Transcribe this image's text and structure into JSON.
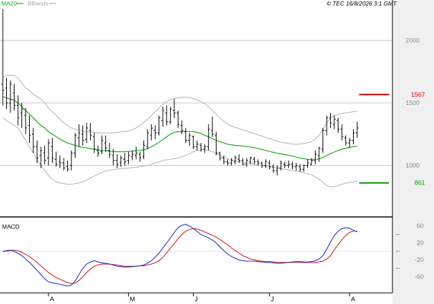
{
  "legend": {
    "ma_label": "MA20",
    "bands_label": "BBands"
  },
  "copyright": "© TEC 16/8/2026 3:1 GMT",
  "colors": {
    "ma": "#1aaa1a",
    "bands": "#b0b0b0",
    "price": "#000000",
    "macd": "#2233cc",
    "signal": "#cc2222",
    "resistance": "#cc0000",
    "support": "#009900",
    "grid": "#c8c8c8",
    "sidebar": "#f0f0f0"
  },
  "chart_data": [
    {
      "type": "line",
      "name": "price",
      "ylim": [
        600,
        2300
      ],
      "y_ticks": [
        1000,
        1500,
        2000
      ],
      "y_tick_labels": [
        "1000",
        "1500",
        "2000"
      ],
      "x_tick_labels": [
        "A",
        "M",
        "J",
        "J",
        "A"
      ],
      "x_tick_index": [
        12,
        33,
        50,
        70,
        91
      ],
      "resistance": {
        "value": 1567,
        "label": "1567"
      },
      "support": {
        "value": 861,
        "label": "861"
      },
      "bars": [
        [
          1650,
          2250,
          1480,
          1600
        ],
        [
          1620,
          1700,
          1450,
          1500
        ],
        [
          1500,
          1680,
          1420,
          1650
        ],
        [
          1580,
          1650,
          1440,
          1480
        ],
        [
          1480,
          1560,
          1320,
          1380
        ],
        [
          1420,
          1500,
          1300,
          1450
        ],
        [
          1400,
          1460,
          1250,
          1300
        ],
        [
          1320,
          1400,
          1180,
          1240
        ],
        [
          1250,
          1300,
          1100,
          1150
        ],
        [
          1150,
          1200,
          1020,
          1060
        ],
        [
          1080,
          1150,
          980,
          1120
        ],
        [
          1100,
          1160,
          1010,
          1040
        ],
        [
          1060,
          1210,
          1000,
          1180
        ],
        [
          1150,
          1220,
          1020,
          1060
        ],
        [
          1050,
          1110,
          990,
          1010
        ],
        [
          1030,
          1080,
          980,
          1020
        ],
        [
          1020,
          1060,
          960,
          980
        ],
        [
          990,
          1040,
          950,
          970
        ],
        [
          1000,
          1120,
          960,
          1100
        ],
        [
          1100,
          1260,
          1060,
          1240
        ],
        [
          1220,
          1330,
          1150,
          1260
        ],
        [
          1250,
          1320,
          1160,
          1200
        ],
        [
          1210,
          1340,
          1180,
          1300
        ],
        [
          1280,
          1340,
          1200,
          1240
        ],
        [
          1230,
          1260,
          1100,
          1130
        ],
        [
          1120,
          1160,
          1070,
          1100
        ],
        [
          1110,
          1240,
          1090,
          1200
        ],
        [
          1180,
          1240,
          1110,
          1140
        ],
        [
          1120,
          1180,
          1060,
          1090
        ],
        [
          1080,
          1130,
          1000,
          1040
        ],
        [
          1040,
          1090,
          980,
          1010
        ],
        [
          1020,
          1080,
          990,
          1060
        ],
        [
          1050,
          1100,
          1000,
          1030
        ],
        [
          1040,
          1110,
          1010,
          1080
        ],
        [
          1070,
          1120,
          1040,
          1090
        ],
        [
          1080,
          1150,
          1050,
          1100
        ],
        [
          1090,
          1110,
          1030,
          1060
        ],
        [
          1070,
          1200,
          1050,
          1160
        ],
        [
          1150,
          1290,
          1130,
          1260
        ],
        [
          1240,
          1330,
          1200,
          1300
        ],
        [
          1280,
          1320,
          1210,
          1260
        ],
        [
          1260,
          1400,
          1240,
          1380
        ],
        [
          1360,
          1470,
          1310,
          1440
        ],
        [
          1420,
          1480,
          1320,
          1350
        ],
        [
          1350,
          1470,
          1330,
          1450
        ],
        [
          1440,
          1530,
          1380,
          1420
        ],
        [
          1420,
          1440,
          1300,
          1330
        ],
        [
          1320,
          1360,
          1250,
          1280
        ],
        [
          1270,
          1300,
          1180,
          1200
        ],
        [
          1200,
          1260,
          1160,
          1240
        ],
        [
          1230,
          1240,
          1130,
          1150
        ],
        [
          1150,
          1200,
          1120,
          1170
        ],
        [
          1160,
          1180,
          1110,
          1130
        ],
        [
          1130,
          1170,
          1100,
          1150
        ],
        [
          1150,
          1330,
          1120,
          1290
        ],
        [
          1280,
          1390,
          1230,
          1250
        ],
        [
          1240,
          1270,
          1080,
          1100
        ],
        [
          1100,
          1110,
          1040,
          1060
        ],
        [
          1060,
          1080,
          1010,
          1030
        ],
        [
          1030,
          1050,
          1000,
          1020
        ],
        [
          1020,
          1060,
          1000,
          1040
        ],
        [
          1030,
          1080,
          1010,
          1060
        ],
        [
          1050,
          1090,
          1020,
          1040
        ],
        [
          1040,
          1060,
          1000,
          1010
        ],
        [
          1010,
          1060,
          990,
          1040
        ],
        [
          1030,
          1070,
          1010,
          1060
        ],
        [
          1050,
          1070,
          1010,
          1030
        ],
        [
          1030,
          1050,
          1000,
          1020
        ],
        [
          1020,
          1030,
          980,
          1000
        ],
        [
          1000,
          1050,
          980,
          1030
        ],
        [
          1020,
          1040,
          970,
          990
        ],
        [
          990,
          1010,
          940,
          960
        ],
        [
          960,
          1000,
          920,
          980
        ],
        [
          980,
          1040,
          960,
          1020
        ],
        [
          1010,
          1030,
          980,
          1000
        ],
        [
          1000,
          1040,
          980,
          1010
        ],
        [
          1010,
          1030,
          970,
          990
        ],
        [
          990,
          1020,
          960,
          1000
        ],
        [
          990,
          1010,
          950,
          970
        ],
        [
          970,
          1010,
          950,
          1000
        ],
        [
          1000,
          1050,
          980,
          1020
        ],
        [
          1010,
          1060,
          1000,
          1040
        ],
        [
          1040,
          1120,
          1010,
          1090
        ],
        [
          1080,
          1150,
          1030,
          1140
        ],
        [
          1130,
          1300,
          1100,
          1280
        ],
        [
          1280,
          1400,
          1240,
          1380
        ],
        [
          1380,
          1420,
          1300,
          1340
        ],
        [
          1330,
          1400,
          1290,
          1370
        ],
        [
          1360,
          1380,
          1260,
          1290
        ],
        [
          1290,
          1330,
          1200,
          1230
        ],
        [
          1220,
          1240,
          1160,
          1180
        ],
        [
          1180,
          1220,
          1140,
          1200
        ],
        [
          1200,
          1290,
          1170,
          1260
        ],
        [
          1260,
          1350,
          1220,
          1300
        ]
      ],
      "ma20": [
        1550,
        1540,
        1530,
        1520,
        1500,
        1470,
        1440,
        1410,
        1380,
        1350,
        1320,
        1300,
        1270,
        1250,
        1230,
        1210,
        1195,
        1180,
        1170,
        1160,
        1150,
        1145,
        1140,
        1135,
        1130,
        1125,
        1120,
        1118,
        1115,
        1112,
        1110,
        1110,
        1110,
        1112,
        1115,
        1118,
        1120,
        1125,
        1135,
        1150,
        1165,
        1185,
        1205,
        1230,
        1250,
        1265,
        1270,
        1270,
        1272,
        1272,
        1270,
        1265,
        1255,
        1240,
        1230,
        1215,
        1200,
        1190,
        1180,
        1170,
        1165,
        1160,
        1158,
        1155,
        1152,
        1148,
        1142,
        1135,
        1128,
        1120,
        1112,
        1105,
        1098,
        1092,
        1088,
        1082,
        1075,
        1068,
        1060,
        1055,
        1050,
        1048,
        1048,
        1052,
        1065,
        1080,
        1095,
        1108,
        1120,
        1130,
        1138,
        1145,
        1150,
        1155
      ],
      "upper_band": [
        1700,
        1720,
        1720,
        1720,
        1700,
        1660,
        1620,
        1600,
        1570,
        1550,
        1530,
        1500,
        1460,
        1430,
        1400,
        1370,
        1340,
        1320,
        1300,
        1290,
        1280,
        1275,
        1270,
        1268,
        1265,
        1262,
        1260,
        1260,
        1260,
        1262,
        1265,
        1268,
        1272,
        1278,
        1285,
        1300,
        1320,
        1345,
        1370,
        1400,
        1430,
        1460,
        1490,
        1510,
        1525,
        1535,
        1540,
        1545,
        1545,
        1542,
        1535,
        1525,
        1510,
        1495,
        1470,
        1440,
        1410,
        1380,
        1350,
        1330,
        1315,
        1305,
        1295,
        1285,
        1275,
        1265,
        1255,
        1245,
        1235,
        1225,
        1215,
        1205,
        1195,
        1185,
        1180,
        1175,
        1172,
        1170,
        1172,
        1175,
        1180,
        1190,
        1210,
        1240,
        1290,
        1340,
        1380,
        1400,
        1410,
        1415,
        1420,
        1425,
        1430,
        1435
      ],
      "lower_band": [
        1380,
        1360,
        1340,
        1320,
        1300,
        1250,
        1200,
        1150,
        1100,
        1050,
        1000,
        960,
        920,
        890,
        870,
        860,
        855,
        850,
        850,
        855,
        860,
        870,
        885,
        900,
        915,
        930,
        945,
        955,
        962,
        968,
        972,
        975,
        978,
        980,
        983,
        985,
        990,
        995,
        1000,
        1010,
        1020,
        1030,
        1040,
        1045,
        1050,
        1055,
        1060,
        1070,
        1080,
        1095,
        1110,
        1120,
        1125,
        1125,
        1120,
        1110,
        1095,
        1080,
        1065,
        1055,
        1045,
        1038,
        1032,
        1025,
        1020,
        1015,
        1010,
        1005,
        1000,
        995,
        990,
        985,
        980,
        975,
        970,
        965,
        960,
        955,
        950,
        942,
        935,
        925,
        910,
        890,
        865,
        840,
        830,
        830,
        840,
        850,
        860,
        865,
        870,
        875
      ]
    },
    {
      "type": "line",
      "name": "MACD",
      "title": "MACD",
      "ylim": [
        -95,
        75
      ],
      "y_ticks": [
        60,
        20,
        -20,
        -60
      ],
      "y_tick_labels": [
        "60",
        "20",
        "-20",
        "-60"
      ],
      "y_zero_ticks": [
        40,
        0,
        -40
      ],
      "macd": [
        0,
        2,
        3,
        0,
        -5,
        -10,
        -18,
        -26,
        -35,
        -45,
        -55,
        -65,
        -72,
        -74,
        -76,
        -78,
        -80,
        -82,
        -80,
        -70,
        -55,
        -40,
        -30,
        -25,
        -22,
        -25,
        -27,
        -28,
        -30,
        -32,
        -35,
        -36,
        -37,
        -37,
        -36,
        -35,
        -34,
        -32,
        -28,
        -22,
        -14,
        -4,
        8,
        20,
        32,
        45,
        56,
        62,
        64,
        60,
        54,
        47,
        40,
        36,
        32,
        27,
        20,
        10,
        2,
        -6,
        -12,
        -16,
        -20,
        -22,
        -23,
        -23,
        -23,
        -24,
        -25,
        -26,
        -26,
        -27,
        -28,
        -28,
        -27,
        -26,
        -25,
        -24,
        -24,
        -25,
        -25,
        -24,
        -22,
        -18,
        -10,
        5,
        22,
        38,
        48,
        54,
        56,
        55,
        50,
        46
      ],
      "signal": [
        0,
        1,
        2,
        3,
        1,
        -2,
        -7,
        -12,
        -19,
        -26,
        -34,
        -42,
        -50,
        -56,
        -62,
        -66,
        -70,
        -74,
        -76,
        -75,
        -69,
        -60,
        -50,
        -42,
        -35,
        -32,
        -30,
        -30,
        -30,
        -31,
        -32,
        -34,
        -35,
        -35,
        -35,
        -35,
        -34,
        -34,
        -32,
        -30,
        -27,
        -22,
        -14,
        -4,
        8,
        18,
        30,
        40,
        48,
        52,
        54,
        53,
        50,
        46,
        42,
        38,
        34,
        28,
        22,
        16,
        8,
        2,
        -4,
        -10,
        -14,
        -18,
        -20,
        -22,
        -23,
        -24,
        -24,
        -25,
        -26,
        -26,
        -26,
        -26,
        -26,
        -26,
        -26,
        -26,
        -26,
        -26,
        -26,
        -25,
        -23,
        -18,
        -10,
        4,
        16,
        28,
        38,
        45,
        48,
        48
      ]
    }
  ]
}
